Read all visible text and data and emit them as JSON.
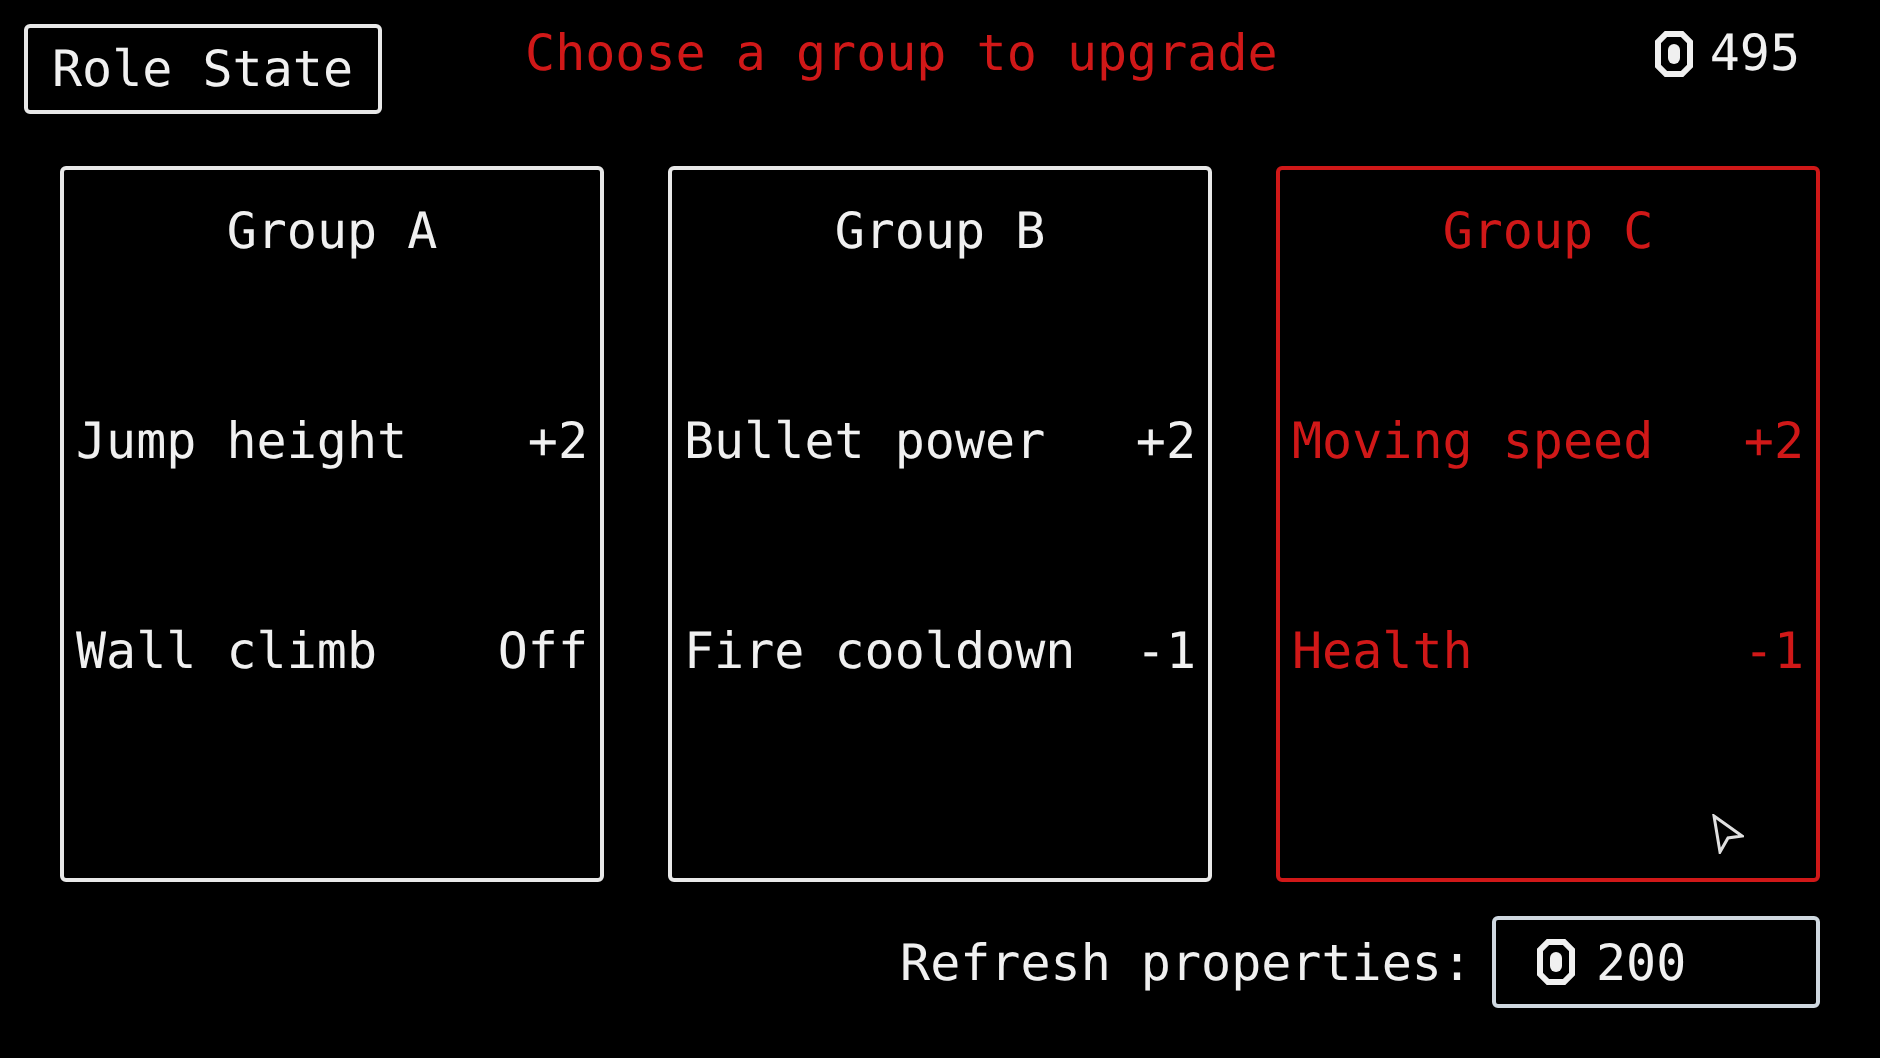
{
  "role_button": "Role State",
  "prompt": "Choose a group to upgrade",
  "coins": "495",
  "groups": [
    {
      "title": "Group A",
      "selected": false,
      "stats": [
        {
          "name": "Jump height",
          "value": "+2"
        },
        {
          "name": "Wall climb",
          "value": "Off"
        }
      ]
    },
    {
      "title": "Group B",
      "selected": false,
      "stats": [
        {
          "name": "Bullet power",
          "value": "+2"
        },
        {
          "name": "Fire cooldown",
          "value": "-1"
        }
      ]
    },
    {
      "title": "Group C",
      "selected": true,
      "stats": [
        {
          "name": "Moving speed",
          "value": "+2"
        },
        {
          "name": "Health",
          "value": "-1"
        }
      ]
    }
  ],
  "refresh": {
    "label": "Refresh properties:",
    "cost": "200"
  }
}
